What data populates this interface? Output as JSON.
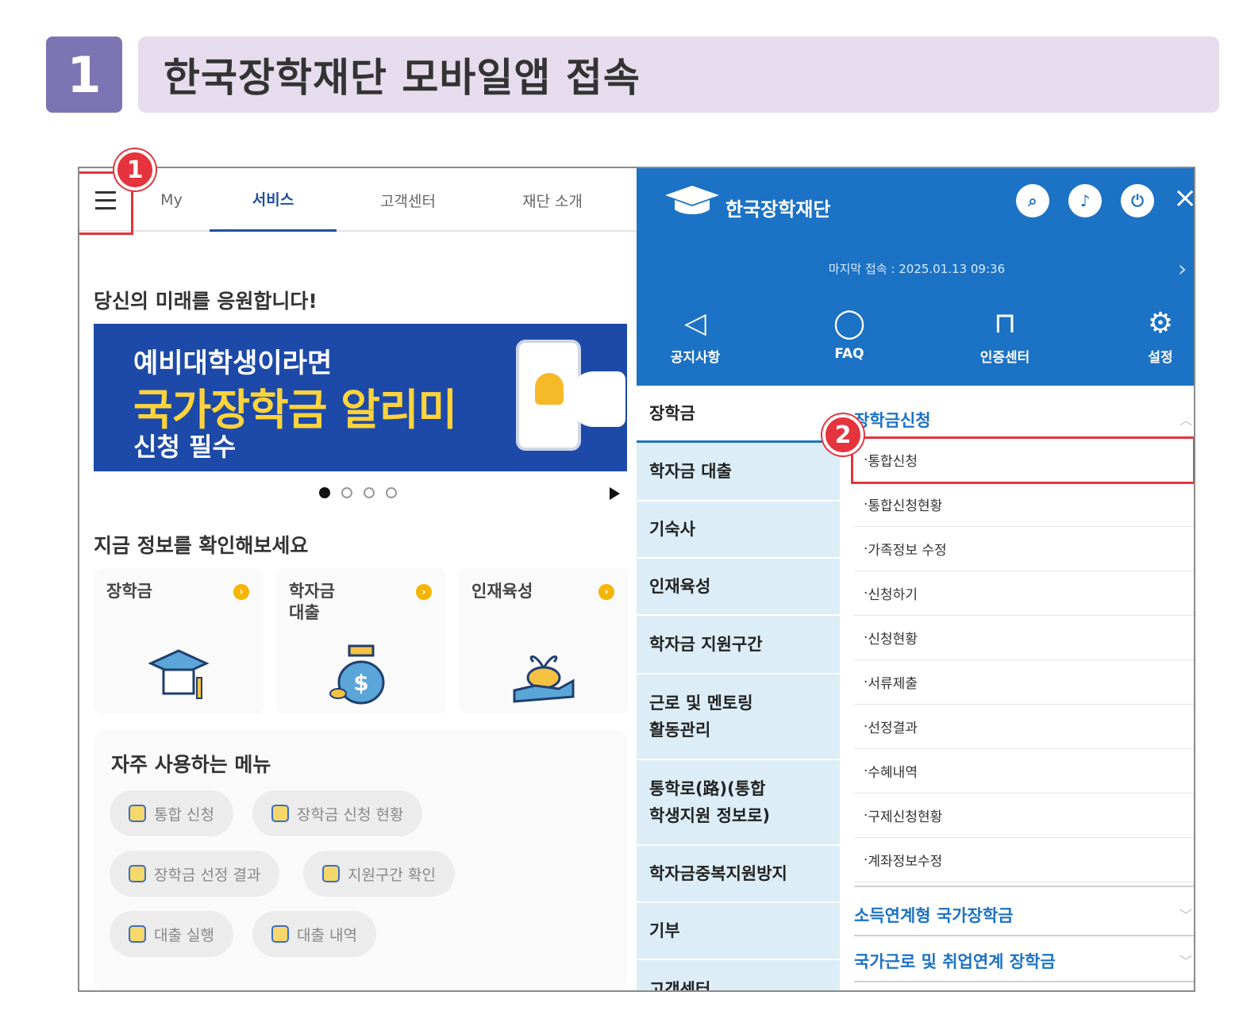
{
  "step": {
    "number": "1",
    "title": "한국장학재단 모바일앱 접속"
  },
  "left": {
    "nav": {
      "my": "My",
      "service": "서비스",
      "customer": "고객센터",
      "about": "재단 소개"
    },
    "greeting": "당신의 미래를 응원합니다!",
    "banner": {
      "line1": "예비대학생이라면",
      "line2": "국가장학금 알리미",
      "line3": "신청 필수"
    },
    "carousel": {
      "total": 4,
      "current": 1
    },
    "info_title": "지금 정보를 확인해보세요",
    "cards": [
      {
        "label": "장학금",
        "icon": "graduation-cap-icon"
      },
      {
        "label": "학자금\n대출",
        "icon": "money-bag-icon"
      },
      {
        "label": "인재육성",
        "icon": "sprout-hand-icon"
      }
    ],
    "frequent": {
      "title": "자주 사용하는 메뉴",
      "items": [
        "통합 신청",
        "장학금 신청 현황",
        "장학금 선정 결과",
        "지원구간 확인",
        "대출 실행",
        "대출 내역"
      ]
    }
  },
  "right": {
    "logo": "한국장학재단",
    "last_login": "마지막 접속 : 2025.01.13 09:36",
    "quick": [
      {
        "label": "공지사항",
        "icon": "speaker-icon"
      },
      {
        "label": "FAQ",
        "icon": "chat-icon"
      },
      {
        "label": "인증센터",
        "icon": "lock-icon"
      },
      {
        "label": "설정",
        "icon": "gear-icon"
      }
    ],
    "categories": [
      "장학금",
      "학자금 대출",
      "기숙사",
      "인재육성",
      "학자금 지원구간",
      "근로 및 멘토링\n활동관리",
      "통학로(路)(통합\n학생지원 정보로)",
      "학자금중복지원방지",
      "기부",
      "고객센터"
    ],
    "sub_group": "장학금신청",
    "sub_items": [
      "통합신청",
      "통합신청현황",
      "가족정보 수정",
      "신청하기",
      "신청현황",
      "서류제출",
      "선정결과",
      "수혜내역",
      "구제신청현황",
      "계좌정보수정"
    ],
    "collapsed_groups": [
      "소득연계형 국가장학금",
      "국가근로 및 취업연계 장학금"
    ]
  },
  "callouts": {
    "one": "1",
    "two": "2"
  },
  "colors": {
    "accent": "#1c72c4",
    "highlight": "#e5343d",
    "step": "#7d74b3"
  }
}
